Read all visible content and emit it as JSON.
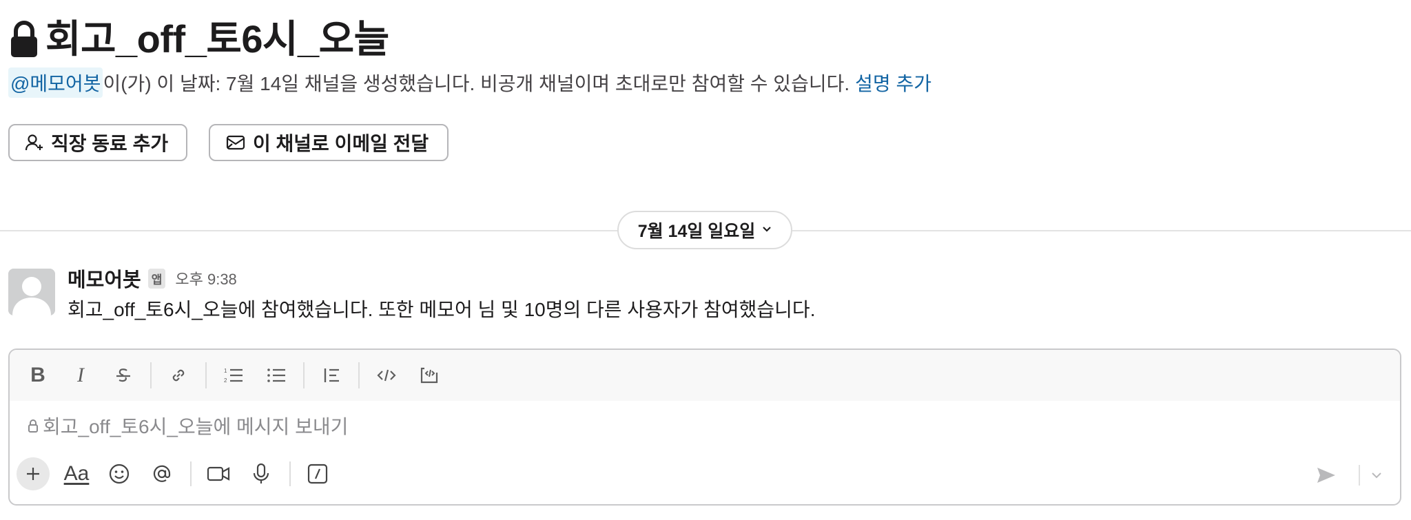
{
  "channel": {
    "title": "회고_off_토6시_오늘",
    "intro": {
      "mention": "@메모어봇",
      "text": "이(가) 이 날짜: 7월 14일 채널을 생성했습니다. 비공개 채널이며 초대로만 참여할 수 있습니다.",
      "link": "설명 추가"
    }
  },
  "actions": {
    "add_coworker": "직장 동료 추가",
    "email_channel": "이 채널로 이메일 전달"
  },
  "date_divider": {
    "label": "7월 14일 일요일"
  },
  "message": {
    "sender": "메모어봇",
    "badge": "앱",
    "time": "오후 9:38",
    "body": "회고_off_토6시_오늘에 참여했습니다. 또한 메모어 님 및 10명의 다른 사용자가 참여했습니다."
  },
  "composer": {
    "placeholder": "회고_off_토6시_오늘에 메시지 보내기",
    "toolbar_icons": [
      "bold-icon",
      "italic-icon",
      "strikethrough-icon",
      "link-icon",
      "ordered-list-icon",
      "bullet-list-icon",
      "blockquote-icon",
      "code-icon",
      "code-block-icon"
    ],
    "bottom_icons": [
      "plus-icon",
      "format-text-icon",
      "emoji-icon",
      "mention-icon",
      "video-icon",
      "microphone-icon",
      "slash-command-icon",
      "send-icon",
      "chevron-down-icon"
    ],
    "format_label": "Aa"
  },
  "colors": {
    "link": "#1264a3",
    "mention_bg": "#e8f5fa",
    "text": "#1d1c1d"
  }
}
